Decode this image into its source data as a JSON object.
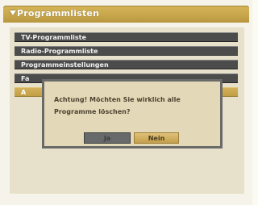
{
  "window": {
    "title": "Programmlisten",
    "collapse_icon": "triangle-down-icon"
  },
  "menu": {
    "items": [
      {
        "label": "TV-Programmliste",
        "selected": false
      },
      {
        "label": "Radio-Programmliste",
        "selected": false
      },
      {
        "label": "Programmeinstellungen",
        "selected": false
      },
      {
        "label": "Fa",
        "selected": false
      },
      {
        "label": "A",
        "selected": true
      }
    ]
  },
  "dialog": {
    "message": "Achtung! Möchten Sie wirklich alle Programme löschen?",
    "yes_label": "Ja",
    "no_label": "Nein"
  },
  "colors": {
    "accent_gold": "#c6a54b",
    "menu_row": "#4c4c4c",
    "dialog_bg": "#e3d8b7",
    "dialog_border": "#6a6a68"
  }
}
